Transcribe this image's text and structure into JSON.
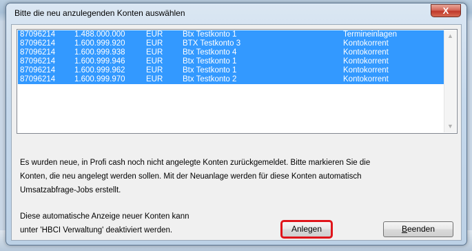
{
  "window": {
    "title": "Bitte die neu anzulegenden Konten auswählen",
    "close_label": "X"
  },
  "accounts": [
    {
      "number": "87096214",
      "amount": "1.488.000.000",
      "currency": "EUR",
      "name": "Btx Testkonto 1",
      "type": "Termineinlagen"
    },
    {
      "number": "87096214",
      "amount": "1.600.999.920",
      "currency": "EUR",
      "name": "BTX Testkonto 3",
      "type": "Kontokorrent"
    },
    {
      "number": "87096214",
      "amount": "1.600.999.938",
      "currency": "EUR",
      "name": "Btx Testkonto 4",
      "type": "Kontokorrent"
    },
    {
      "number": "87096214",
      "amount": "1.600.999.946",
      "currency": "EUR",
      "name": "Btx Testkonto 1",
      "type": "Kontokorrent"
    },
    {
      "number": "87096214",
      "amount": "1.600.999.962",
      "currency": "EUR",
      "name": "Btx Testkonto 1",
      "type": "Kontokorrent"
    },
    {
      "number": "87096214",
      "amount": "1.600.999.970",
      "currency": "EUR",
      "name": "Btx Testkonto 2",
      "type": "Kontokorrent"
    }
  ],
  "info": {
    "line1": "Es wurden neue, in Profi cash noch nicht angelegte Konten zurückgemeldet. Bitte markieren Sie die",
    "line2": "Konten, die neu angelegt werden sollen. Mit der Neuanlage werden für diese Konten automatisch",
    "line3": "Umsatzabfrage-Jobs erstellt."
  },
  "footer": {
    "line1": "Diese automatische Anzeige neuer Konten kann",
    "line2": "unter 'HBCI Verwaltung' deaktiviert werden."
  },
  "buttons": {
    "create_label": "Anlegen",
    "close_label_first": "B",
    "close_label_rest": "eenden"
  },
  "colors": {
    "selection": "#3399ff",
    "highlight_box": "#e0141a"
  },
  "icons": {
    "scroll_up": "chevron-up-icon",
    "scroll_down": "chevron-down-icon"
  }
}
